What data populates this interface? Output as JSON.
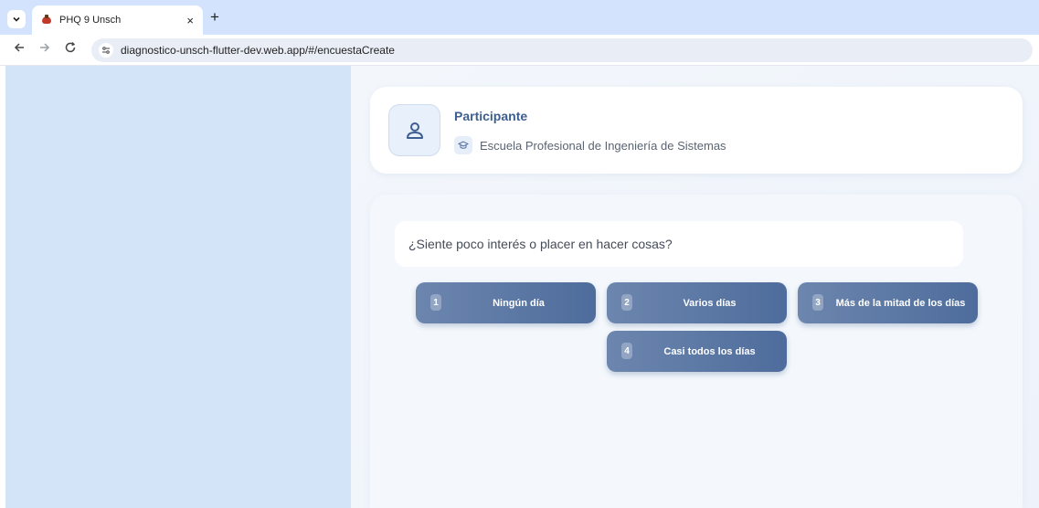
{
  "browser": {
    "tab_title": "PHQ 9 Unsch",
    "tab_close": "×",
    "new_tab": "+",
    "url": "diagnostico-unsch-flutter-dev.web.app/#/encuestaCreate"
  },
  "participant": {
    "title": "Participante",
    "school": "Escuela Profesional de Ingeniería de Sistemas"
  },
  "question": {
    "text": "¿Siente poco interés o placer en hacer cosas?"
  },
  "options": [
    {
      "number": "1",
      "label": "Ningún día"
    },
    {
      "number": "2",
      "label": "Varios días"
    },
    {
      "number": "3",
      "label": "Más de la mitad de los días"
    },
    {
      "number": "4",
      "label": "Casi todos los días"
    }
  ],
  "icons": {
    "tab_search": "chevron-down-icon",
    "back": "back-arrow-icon",
    "forward": "forward-arrow-icon",
    "reload": "reload-icon",
    "site_info": "tune-icon",
    "avatar": "person-icon",
    "school": "graduation-cap-icon"
  }
}
